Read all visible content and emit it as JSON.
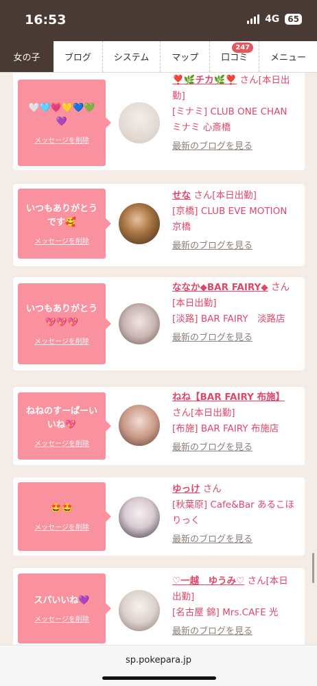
{
  "status": {
    "time": "16:53",
    "network": "4G",
    "battery": "65"
  },
  "nav": {
    "tabs": [
      {
        "label": "女の子"
      },
      {
        "label": "ブログ"
      },
      {
        "label": "システム"
      },
      {
        "label": "マップ"
      },
      {
        "label": "口コミ",
        "badge": "247"
      },
      {
        "label": "メニュー"
      }
    ]
  },
  "cards": [
    {
      "message": "🤍🩵💗💛💙💚💜",
      "delete_label": "メッセージを削除",
      "name": "❣️🌿チカ🌿❣️",
      "suffix": "さん[本日出勤]",
      "shop": "[ミナミ] CLUB ONE CHAN ミナミ 心斎橋",
      "blog_label": "最新のブログを見る"
    },
    {
      "message": "いつもありがとうです🥰",
      "delete_label": "メッセージを削除",
      "name": "せな",
      "suffix": "さん[本日出勤]",
      "shop": "[京橋] CLUB EVE MOTION 京橋",
      "blog_label": "最新のブログを見る"
    },
    {
      "message": "いつもありがとう💖💖💖",
      "delete_label": "メッセージを削除",
      "name": "ななか◆BAR FAIRY◆",
      "suffix": "さん[本日出勤]",
      "shop": "[淡路] BAR FAIRY　淡路店",
      "blog_label": "最新のブログを見る"
    },
    {
      "message": "ねねのすーぱーいいね💖",
      "delete_label": "メッセージを削除",
      "name": "ねね【BAR FAIRY 布施】",
      "suffix": "さん[本日出勤]",
      "shop": "[布施] BAR FAIRY 布施店",
      "blog_label": "最新のブログを見る"
    },
    {
      "message": "🤩🤩",
      "delete_label": "メッセージを削除",
      "name": "ゆっけ",
      "suffix": "さん",
      "shop": "[秋葉原] Cafe&Bar あるこほりっく",
      "blog_label": "最新のブログを見る"
    },
    {
      "message": "スパいいね💜",
      "delete_label": "メッセージを削除",
      "name": "♡一越　ゆうみ♡",
      "suffix": "さん[本日出勤]",
      "shop": "[名古屋 錦] Mrs.CAFE 光",
      "blog_label": "最新のブログを見る"
    }
  ],
  "browser": {
    "url": "sp.pokepara.jp"
  },
  "colors": {
    "accent": "#e0456a",
    "message_bg": "#f9919f",
    "nav_active": "#4a3a34"
  }
}
